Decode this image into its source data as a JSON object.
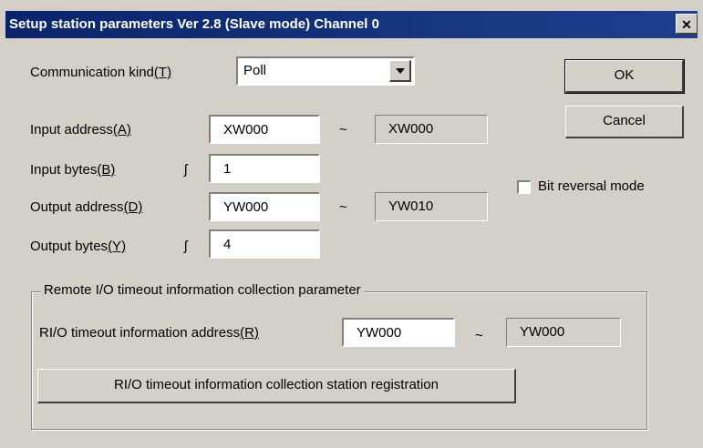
{
  "dialog": {
    "title": "Setup station parameters Ver 2.8 (Slave mode) Channel 0",
    "close_glyph": "✕"
  },
  "communication_kind": {
    "label": "Communication kind",
    "accel": "(T)",
    "value": "Poll"
  },
  "input_address": {
    "label": "Input address",
    "accel": "(A)",
    "start": "XW000",
    "tilde": "~",
    "end": "XW000"
  },
  "input_bytes": {
    "label": "Input bytes",
    "accel": "(B)",
    "mark": "ʃ",
    "value": "1"
  },
  "output_address": {
    "label": "Output address",
    "accel": "(D)",
    "start": "YW000",
    "tilde": "~",
    "end": "YW010"
  },
  "output_bytes": {
    "label": "Output bytes",
    "accel": "(Y)",
    "mark": "ʃ",
    "value": "4"
  },
  "buttons": {
    "ok": "OK",
    "cancel": "Cancel"
  },
  "bit_reversal": {
    "label": "Bit reversal mode",
    "checked": false
  },
  "remote_group": {
    "legend": "Remote I/O timeout information collection parameter",
    "rio_label": "RI/O timeout information address",
    "rio_accel": "(R)",
    "rio_start": "YW000",
    "tilde": "~",
    "rio_end": "YW000",
    "registration_button": "RI/O timeout information collection station registration"
  }
}
